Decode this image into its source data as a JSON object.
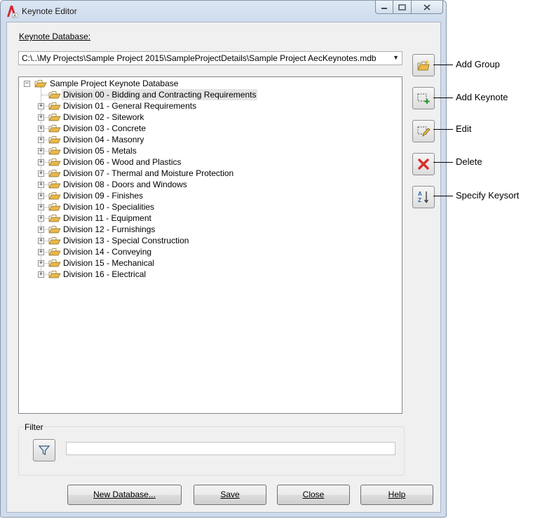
{
  "window": {
    "title": "Keynote Editor"
  },
  "database": {
    "label": "Keynote Database:",
    "path": "C:\\..\\My Projects\\Sample Project 2015\\SampleProjectDetails\\Sample Project AecKeynotes.mdb"
  },
  "tree": {
    "root": "Sample Project Keynote Database",
    "items": [
      "Division 00 - Bidding and Contracting Requirements",
      "Division 01 - General Requirements",
      "Division 02 - Sitework",
      "Division 03 - Concrete",
      "Division 04 - Masonry",
      "Division 05 - Metals",
      "Division 06 - Wood and Plastics",
      "Division 07 - Thermal and Moisture Protection",
      "Division 08 - Doors and Windows",
      "Division 09 - Finishes",
      "Division 10 - Specialities",
      "Division 11 - Equipment",
      "Division 12 - Furnishings",
      "Division 13 - Special Construction",
      "Division 14 - Conveying",
      "Division 15 - Mechanical",
      "Division 16 - Electrical"
    ],
    "selected_index": 0
  },
  "filter": {
    "label": "Filter",
    "value": ""
  },
  "buttons": {
    "new_database": "New Database...",
    "save": "Save",
    "close": "Close",
    "help": "Help"
  },
  "callouts": {
    "add_group": "Add Group",
    "add_keynote": "Add Keynote",
    "edit": "Edit",
    "delete": "Delete",
    "specify_keysort": "Specify Keysort"
  },
  "colors": {
    "delete_icon": "#d9302b",
    "add_icon": "#2e9a2e",
    "folder_icon": "#e8b84a"
  }
}
